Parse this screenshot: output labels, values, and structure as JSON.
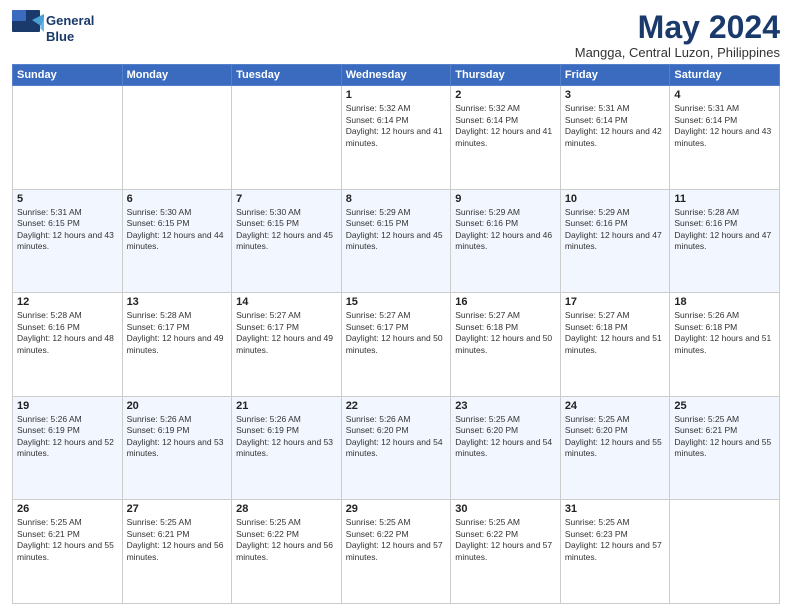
{
  "header": {
    "logo_line1": "General",
    "logo_line2": "Blue",
    "title": "May 2024",
    "location": "Mangga, Central Luzon, Philippines"
  },
  "days_of_week": [
    "Sunday",
    "Monday",
    "Tuesday",
    "Wednesday",
    "Thursday",
    "Friday",
    "Saturday"
  ],
  "weeks": [
    [
      {
        "day": "",
        "sunrise": "",
        "sunset": "",
        "daylight": "",
        "empty": true
      },
      {
        "day": "",
        "sunrise": "",
        "sunset": "",
        "daylight": "",
        "empty": true
      },
      {
        "day": "",
        "sunrise": "",
        "sunset": "",
        "daylight": "",
        "empty": true
      },
      {
        "day": "1",
        "sunrise": "Sunrise: 5:32 AM",
        "sunset": "Sunset: 6:14 PM",
        "daylight": "Daylight: 12 hours and 41 minutes."
      },
      {
        "day": "2",
        "sunrise": "Sunrise: 5:32 AM",
        "sunset": "Sunset: 6:14 PM",
        "daylight": "Daylight: 12 hours and 41 minutes."
      },
      {
        "day": "3",
        "sunrise": "Sunrise: 5:31 AM",
        "sunset": "Sunset: 6:14 PM",
        "daylight": "Daylight: 12 hours and 42 minutes."
      },
      {
        "day": "4",
        "sunrise": "Sunrise: 5:31 AM",
        "sunset": "Sunset: 6:14 PM",
        "daylight": "Daylight: 12 hours and 43 minutes."
      }
    ],
    [
      {
        "day": "5",
        "sunrise": "Sunrise: 5:31 AM",
        "sunset": "Sunset: 6:15 PM",
        "daylight": "Daylight: 12 hours and 43 minutes."
      },
      {
        "day": "6",
        "sunrise": "Sunrise: 5:30 AM",
        "sunset": "Sunset: 6:15 PM",
        "daylight": "Daylight: 12 hours and 44 minutes."
      },
      {
        "day": "7",
        "sunrise": "Sunrise: 5:30 AM",
        "sunset": "Sunset: 6:15 PM",
        "daylight": "Daylight: 12 hours and 45 minutes."
      },
      {
        "day": "8",
        "sunrise": "Sunrise: 5:29 AM",
        "sunset": "Sunset: 6:15 PM",
        "daylight": "Daylight: 12 hours and 45 minutes."
      },
      {
        "day": "9",
        "sunrise": "Sunrise: 5:29 AM",
        "sunset": "Sunset: 6:16 PM",
        "daylight": "Daylight: 12 hours and 46 minutes."
      },
      {
        "day": "10",
        "sunrise": "Sunrise: 5:29 AM",
        "sunset": "Sunset: 6:16 PM",
        "daylight": "Daylight: 12 hours and 47 minutes."
      },
      {
        "day": "11",
        "sunrise": "Sunrise: 5:28 AM",
        "sunset": "Sunset: 6:16 PM",
        "daylight": "Daylight: 12 hours and 47 minutes."
      }
    ],
    [
      {
        "day": "12",
        "sunrise": "Sunrise: 5:28 AM",
        "sunset": "Sunset: 6:16 PM",
        "daylight": "Daylight: 12 hours and 48 minutes."
      },
      {
        "day": "13",
        "sunrise": "Sunrise: 5:28 AM",
        "sunset": "Sunset: 6:17 PM",
        "daylight": "Daylight: 12 hours and 49 minutes."
      },
      {
        "day": "14",
        "sunrise": "Sunrise: 5:27 AM",
        "sunset": "Sunset: 6:17 PM",
        "daylight": "Daylight: 12 hours and 49 minutes."
      },
      {
        "day": "15",
        "sunrise": "Sunrise: 5:27 AM",
        "sunset": "Sunset: 6:17 PM",
        "daylight": "Daylight: 12 hours and 50 minutes."
      },
      {
        "day": "16",
        "sunrise": "Sunrise: 5:27 AM",
        "sunset": "Sunset: 6:18 PM",
        "daylight": "Daylight: 12 hours and 50 minutes."
      },
      {
        "day": "17",
        "sunrise": "Sunrise: 5:27 AM",
        "sunset": "Sunset: 6:18 PM",
        "daylight": "Daylight: 12 hours and 51 minutes."
      },
      {
        "day": "18",
        "sunrise": "Sunrise: 5:26 AM",
        "sunset": "Sunset: 6:18 PM",
        "daylight": "Daylight: 12 hours and 51 minutes."
      }
    ],
    [
      {
        "day": "19",
        "sunrise": "Sunrise: 5:26 AM",
        "sunset": "Sunset: 6:19 PM",
        "daylight": "Daylight: 12 hours and 52 minutes."
      },
      {
        "day": "20",
        "sunrise": "Sunrise: 5:26 AM",
        "sunset": "Sunset: 6:19 PM",
        "daylight": "Daylight: 12 hours and 53 minutes."
      },
      {
        "day": "21",
        "sunrise": "Sunrise: 5:26 AM",
        "sunset": "Sunset: 6:19 PM",
        "daylight": "Daylight: 12 hours and 53 minutes."
      },
      {
        "day": "22",
        "sunrise": "Sunrise: 5:26 AM",
        "sunset": "Sunset: 6:20 PM",
        "daylight": "Daylight: 12 hours and 54 minutes."
      },
      {
        "day": "23",
        "sunrise": "Sunrise: 5:25 AM",
        "sunset": "Sunset: 6:20 PM",
        "daylight": "Daylight: 12 hours and 54 minutes."
      },
      {
        "day": "24",
        "sunrise": "Sunrise: 5:25 AM",
        "sunset": "Sunset: 6:20 PM",
        "daylight": "Daylight: 12 hours and 55 minutes."
      },
      {
        "day": "25",
        "sunrise": "Sunrise: 5:25 AM",
        "sunset": "Sunset: 6:21 PM",
        "daylight": "Daylight: 12 hours and 55 minutes."
      }
    ],
    [
      {
        "day": "26",
        "sunrise": "Sunrise: 5:25 AM",
        "sunset": "Sunset: 6:21 PM",
        "daylight": "Daylight: 12 hours and 55 minutes."
      },
      {
        "day": "27",
        "sunrise": "Sunrise: 5:25 AM",
        "sunset": "Sunset: 6:21 PM",
        "daylight": "Daylight: 12 hours and 56 minutes."
      },
      {
        "day": "28",
        "sunrise": "Sunrise: 5:25 AM",
        "sunset": "Sunset: 6:22 PM",
        "daylight": "Daylight: 12 hours and 56 minutes."
      },
      {
        "day": "29",
        "sunrise": "Sunrise: 5:25 AM",
        "sunset": "Sunset: 6:22 PM",
        "daylight": "Daylight: 12 hours and 57 minutes."
      },
      {
        "day": "30",
        "sunrise": "Sunrise: 5:25 AM",
        "sunset": "Sunset: 6:22 PM",
        "daylight": "Daylight: 12 hours and 57 minutes."
      },
      {
        "day": "31",
        "sunrise": "Sunrise: 5:25 AM",
        "sunset": "Sunset: 6:23 PM",
        "daylight": "Daylight: 12 hours and 57 minutes."
      },
      {
        "day": "",
        "sunrise": "",
        "sunset": "",
        "daylight": "",
        "empty": true
      }
    ]
  ]
}
